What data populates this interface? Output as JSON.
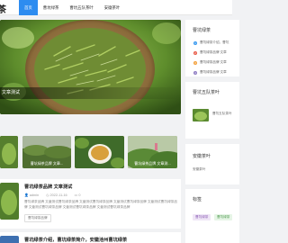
{
  "header": {
    "logo": "茶",
    "nav": [
      "首页",
      "曹坑绿茶",
      "曹坑五队茶叶",
      "安徽茶叶"
    ]
  },
  "hero": {
    "caption": "文章测试"
  },
  "thumbs": [
    {
      "caption": ""
    },
    {
      "caption": "曹坑绿茶品牌 文章..."
    },
    {
      "caption": ""
    },
    {
      "caption": "曹坑绿茶品牌 文章测..."
    }
  ],
  "article": {
    "title": "曹坑绿茶品牌 文章测试",
    "author": "admin",
    "date": "2022-11-16",
    "comments": "0",
    "summary": "曹坑绿茶品牌 文章测试曹坑绿茶品牌 文章测试曹坑绿茶品牌 文章测试曹坑绿茶品牌 文章测试曹坑绿茶品牌 文章测试曹坑绿茶品牌 文章测试曹坑绿茶品牌 文章测试曹坑绿茶品牌",
    "tag": "曹坑绿茶品牌"
  },
  "article2": {
    "title": "曹坑绿茶介绍，曹坑绿茶简介，安徽池州曹坑绿茶"
  },
  "sidebar": {
    "cat1": {
      "title": "曹坑绿茶",
      "items": [
        {
          "n": "1",
          "text": "曹坑绿茶介绍，曹坑"
        },
        {
          "n": "2",
          "text": "曹坑绿茶品牌 文章"
        },
        {
          "n": "3",
          "text": "曹坑绿茶品牌 文章"
        },
        {
          "n": "4",
          "text": "曹坑绿茶品牌 文章"
        }
      ]
    },
    "cat2": {
      "title": "曹坑五队茶叶",
      "items": [
        {
          "text": "曹坑五队茶叶"
        }
      ]
    },
    "cat3": {
      "title": "安徽茶叶",
      "items": [
        {
          "text": "安徽茶叶"
        }
      ]
    },
    "tags": {
      "title": "标签",
      "items": [
        "曹坑绿茶",
        "曹坑绿茶"
      ]
    }
  },
  "colors": {
    "accent": "#2d8cf0",
    "rank1": "#3d9cf0",
    "rank2": "#e85d4b",
    "rank3": "#f4a13d",
    "rank4": "#8e7cc3"
  }
}
